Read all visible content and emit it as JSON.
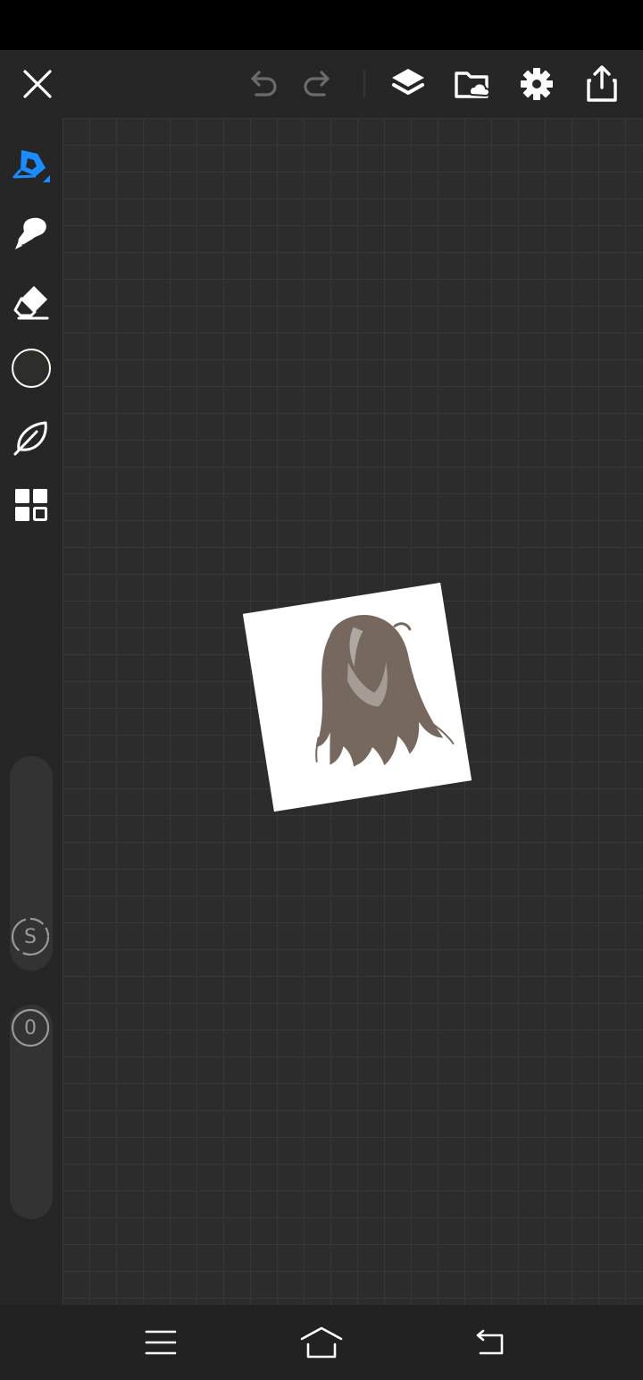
{
  "colors": {
    "accent": "#1a8cff",
    "icon": "#ffffff",
    "icon_dim": "#6b6b6b",
    "toolbar_bg": "#262626",
    "canvas_bg": "#2c2c2c",
    "current_color": "#2d2d2a",
    "hair": "#77685f"
  },
  "top_toolbar": {
    "icons": [
      "close-icon",
      "undo-icon",
      "redo-icon",
      "layers-icon",
      "folder-cloud-icon",
      "gear-icon",
      "share-icon"
    ]
  },
  "left_toolbar": {
    "tools": [
      "pen-icon",
      "smudge-icon",
      "eraser-icon",
      "color-swatch",
      "leaf-icon",
      "grid-icon"
    ],
    "size_slider": {
      "knob_label": "S"
    },
    "opacity_slider": {
      "knob_label": "0"
    }
  },
  "nav_bar": {
    "icons": [
      "menu-icon",
      "home-icon",
      "back-icon"
    ]
  }
}
